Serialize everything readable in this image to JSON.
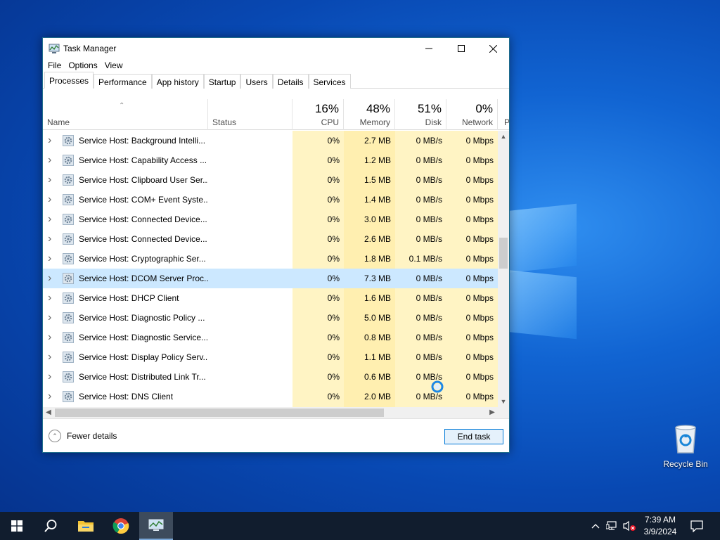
{
  "window": {
    "title": "Task Manager",
    "minimize_label": "",
    "maximize_label": "",
    "close_label": ""
  },
  "menu": [
    "File",
    "Options",
    "View"
  ],
  "tabs": [
    "Processes",
    "Performance",
    "App history",
    "Startup",
    "Users",
    "Details",
    "Services"
  ],
  "active_tab": "Processes",
  "columns": {
    "name": "Name",
    "status": "Status",
    "cpu": {
      "label": "CPU",
      "percent": "16%"
    },
    "memory": {
      "label": "Memory",
      "percent": "48%"
    },
    "disk": {
      "label": "Disk",
      "percent": "51%"
    },
    "network": {
      "label": "Network",
      "percent": "0%"
    },
    "power_partial": "P"
  },
  "processes": [
    {
      "name": "Service Host: Background Intelli...",
      "status": "",
      "cpu": "0%",
      "memory": "2.7 MB",
      "disk": "0 MB/s",
      "network": "0 Mbps"
    },
    {
      "name": "Service Host: Capability Access ...",
      "status": "",
      "cpu": "0%",
      "memory": "1.2 MB",
      "disk": "0 MB/s",
      "network": "0 Mbps"
    },
    {
      "name": "Service Host: Clipboard User Ser...",
      "status": "",
      "cpu": "0%",
      "memory": "1.5 MB",
      "disk": "0 MB/s",
      "network": "0 Mbps"
    },
    {
      "name": "Service Host: COM+ Event Syste...",
      "status": "",
      "cpu": "0%",
      "memory": "1.4 MB",
      "disk": "0 MB/s",
      "network": "0 Mbps"
    },
    {
      "name": "Service Host: Connected Device...",
      "status": "",
      "cpu": "0%",
      "memory": "3.0 MB",
      "disk": "0 MB/s",
      "network": "0 Mbps"
    },
    {
      "name": "Service Host: Connected Device...",
      "status": "",
      "cpu": "0%",
      "memory": "2.6 MB",
      "disk": "0 MB/s",
      "network": "0 Mbps"
    },
    {
      "name": "Service Host: Cryptographic Ser...",
      "status": "",
      "cpu": "0%",
      "memory": "1.8 MB",
      "disk": "0.1 MB/s",
      "network": "0 Mbps"
    },
    {
      "name": "Service Host: DCOM Server Proc...",
      "status": "",
      "cpu": "0%",
      "memory": "7.3 MB",
      "disk": "0 MB/s",
      "network": "0 Mbps",
      "selected": true
    },
    {
      "name": "Service Host: DHCP Client",
      "status": "",
      "cpu": "0%",
      "memory": "1.6 MB",
      "disk": "0 MB/s",
      "network": "0 Mbps"
    },
    {
      "name": "Service Host: Diagnostic Policy ...",
      "status": "",
      "cpu": "0%",
      "memory": "5.0 MB",
      "disk": "0 MB/s",
      "network": "0 Mbps"
    },
    {
      "name": "Service Host: Diagnostic Service...",
      "status": "",
      "cpu": "0%",
      "memory": "0.8 MB",
      "disk": "0 MB/s",
      "network": "0 Mbps"
    },
    {
      "name": "Service Host: Display Policy Serv...",
      "status": "",
      "cpu": "0%",
      "memory": "1.1 MB",
      "disk": "0 MB/s",
      "network": "0 Mbps"
    },
    {
      "name": "Service Host: Distributed Link Tr...",
      "status": "",
      "cpu": "0%",
      "memory": "0.6 MB",
      "disk": "0 MB/s",
      "network": "0 Mbps"
    },
    {
      "name": "Service Host: DNS Client",
      "status": "",
      "cpu": "0%",
      "memory": "2.0 MB",
      "disk": "0 MB/s",
      "network": "0 Mbps"
    }
  ],
  "footer": {
    "fewer_details": "Fewer details",
    "end_task": "End task"
  },
  "desktop": {
    "recycle_bin": "Recycle Bin"
  },
  "taskbar": {
    "time": "7:39 AM",
    "date": "3/9/2024",
    "icons": [
      "start-icon",
      "search-icon",
      "file-explorer-icon",
      "chrome-icon",
      "task-manager-icon"
    ]
  },
  "colors": {
    "heat_light": "#fff4c4",
    "heat_medium": "#ffefb0",
    "selected_row": "#cce8ff",
    "accent": "#0078d7"
  }
}
